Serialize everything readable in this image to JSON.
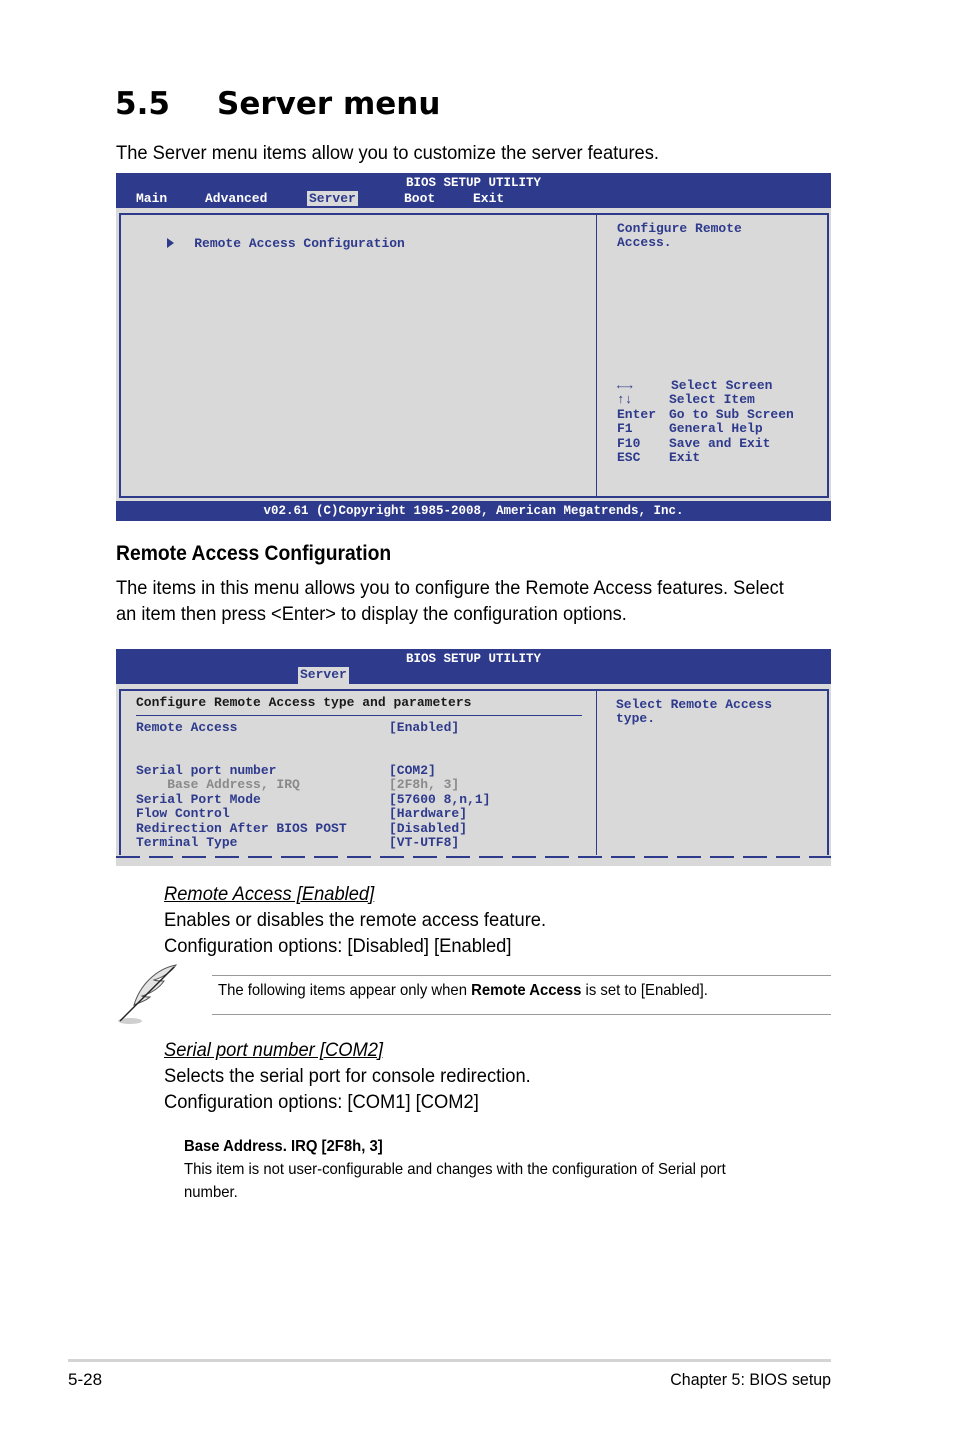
{
  "section": {
    "number": "5.5",
    "title": "Server menu",
    "intro": "The Server menu items allow you to customize the server features."
  },
  "bios1": {
    "title": "BIOS SETUP UTILITY",
    "tabs": [
      {
        "label": "Main",
        "active": false
      },
      {
        "label": "Advanced",
        "active": false
      },
      {
        "label": "Server",
        "active": true
      },
      {
        "label": "Boot",
        "active": false
      },
      {
        "label": "Exit",
        "active": false
      }
    ],
    "menu_items": [
      {
        "label": "Remote Access Configuration",
        "icon": "submenu-arrow-icon"
      }
    ],
    "help_text": [
      "Configure Remote",
      "Access."
    ],
    "keys": [
      {
        "key": "←→",
        "action": "Select Screen"
      },
      {
        "key": "↑↓",
        "action": "Select Item"
      },
      {
        "key": "Enter",
        "action": "Go to Sub Screen"
      },
      {
        "key": "F1",
        "action": "General Help"
      },
      {
        "key": "F10",
        "action": "Save and Exit"
      },
      {
        "key": "ESC",
        "action": "Exit"
      }
    ],
    "footer": "v02.61 (C)Copyright 1985-2008, American Megatrends, Inc."
  },
  "subsection": {
    "title": "Remote Access Configuration",
    "para_lines": [
      "The items in this menu allows you to configure the Remote Access features. Select",
      "an item then press <Enter> to display the configuration options."
    ]
  },
  "bios2": {
    "title": "BIOS SETUP UTILITY",
    "active_tab": "Server",
    "heading": "Configure Remote Access type and parameters",
    "items": [
      {
        "label": "Remote Access",
        "value": "[Enabled]",
        "state": "normal"
      },
      {
        "label": "Serial port number",
        "value": "[COM2]",
        "state": "normal"
      },
      {
        "label": "    Base Address, IRQ",
        "value": "[2F8h, 3]",
        "state": "disabled"
      },
      {
        "label": "Serial Port Mode",
        "value": "[57600 8,n,1]",
        "state": "normal"
      },
      {
        "label": "Flow Control",
        "value": "[Hardware]",
        "state": "normal"
      },
      {
        "label": "Redirection After BIOS POST",
        "value": "[Disabled]",
        "state": "normal"
      },
      {
        "label": "Terminal Type",
        "value": "[VT-UTF8]",
        "state": "normal"
      }
    ],
    "help_text": [
      "Select Remote Access",
      "type."
    ]
  },
  "remote_access": {
    "title": "Remote Access [Enabled]",
    "desc": "Enables or disables the remote access feature.",
    "options": "Configuration options: [Disabled] [Enabled]"
  },
  "note": {
    "icon": "feather-pen-icon",
    "before": "The following items appear only when ",
    "bold": "Remote Access",
    "after": " is set to [Enabled]."
  },
  "serial_port": {
    "title": "Serial port number [COM2]",
    "desc": "Selects the serial port for console redirection.",
    "options": "Configuration options: [COM1] [COM2]"
  },
  "base_address": {
    "title": "Base Address. IRQ [2F8h, 3]",
    "desc_lines": [
      "This item is not user-configurable and changes with the configuration of Serial port",
      "number."
    ]
  },
  "footer": {
    "page": "5-28",
    "chapter": "Chapter 5: BIOS setup"
  }
}
